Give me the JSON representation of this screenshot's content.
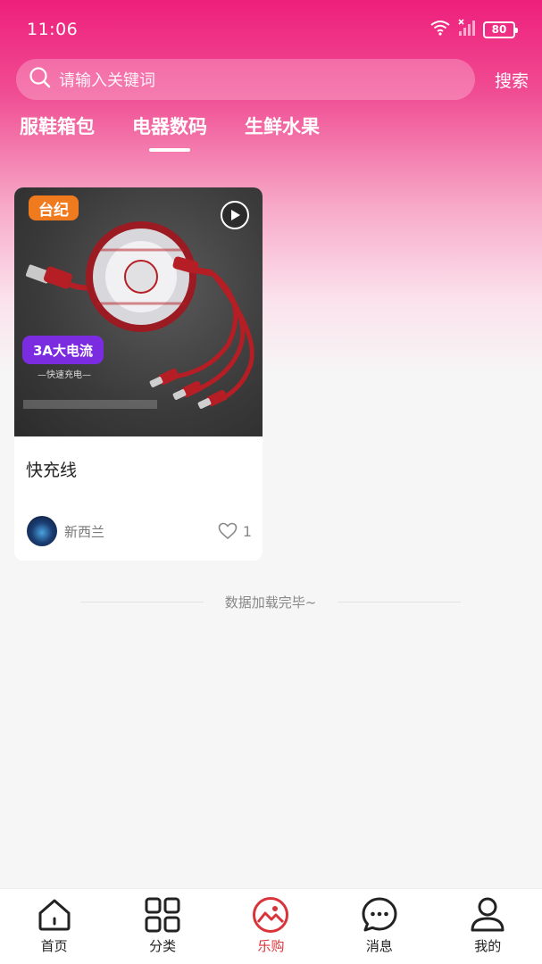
{
  "status_bar": {
    "time": "11:06",
    "battery": "80"
  },
  "search": {
    "placeholder": "请输入关键词",
    "button_label": "搜索"
  },
  "tabs": [
    {
      "label": "服鞋箱包",
      "active": false
    },
    {
      "label": "电器数码",
      "active": true
    },
    {
      "label": "生鲜水果",
      "active": false
    }
  ],
  "product_card": {
    "badge": "台纪",
    "promo_label": "3A大电流",
    "promo_sub": "—快速充电—",
    "title": "快充线",
    "author": "新西兰",
    "likes": "1"
  },
  "list_end_text": "数据加载完毕~",
  "bottom_nav": [
    {
      "label": "首页",
      "icon": "home-icon"
    },
    {
      "label": "分类",
      "icon": "grid-icon"
    },
    {
      "label": "乐购",
      "icon": "image-icon",
      "active": true
    },
    {
      "label": "消息",
      "icon": "message-icon"
    },
    {
      "label": "我的",
      "icon": "user-icon"
    }
  ],
  "colors": {
    "brand_pink": "#ee1f7c",
    "active_nav": "#d8343a",
    "badge_orange": "#f07a1e",
    "promo_purple": "#7b2be0"
  }
}
